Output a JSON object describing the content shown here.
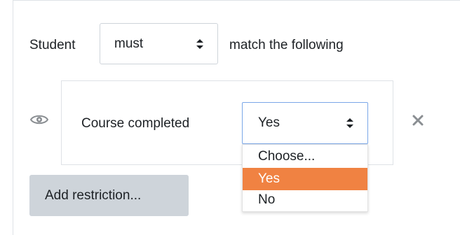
{
  "header": {
    "prefix_label": "Student",
    "match_select_value": "must",
    "suffix_label": "match the following"
  },
  "condition": {
    "label": "Course completed",
    "select_value": "Yes",
    "options": [
      "Choose...",
      "Yes",
      "No"
    ],
    "selected_option": "Yes"
  },
  "actions": {
    "add_restriction_label": "Add restriction..."
  },
  "icons": {
    "eye": "eye-icon",
    "delete": "close-icon",
    "select_arrows": "chevron-updown-icon"
  },
  "colors": {
    "selected_option_bg": "#f08242",
    "focus_border": "#7aa7e8",
    "button_bg": "#ced4da"
  }
}
